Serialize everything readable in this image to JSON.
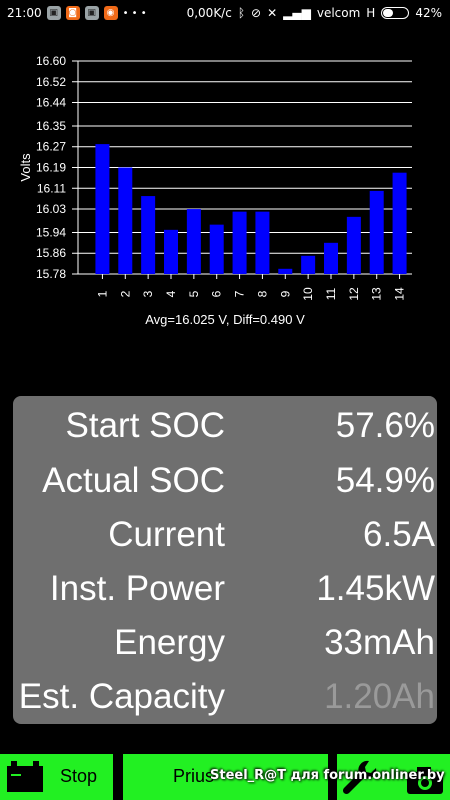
{
  "status_bar": {
    "time": "21:00",
    "more": "• • •",
    "net_speed": "0,00K/c",
    "carrier": "velcom",
    "network": "H",
    "battery": "42%",
    "battery_level": 0.42
  },
  "chart_data": {
    "type": "bar",
    "ylabel": "Volts",
    "xlabel": "",
    "categories": [
      "1",
      "2",
      "3",
      "4",
      "5",
      "6",
      "7",
      "8",
      "9",
      "10",
      "11",
      "12",
      "13",
      "14"
    ],
    "values": [
      16.28,
      16.19,
      16.08,
      15.95,
      16.03,
      15.97,
      16.02,
      16.02,
      15.8,
      15.85,
      15.9,
      16.0,
      16.1,
      16.17
    ],
    "ylim": [
      15.78,
      16.6
    ],
    "yticks": [
      "15.78",
      "15.86",
      "15.94",
      "16.03",
      "16.11",
      "16.19",
      "16.27",
      "16.35",
      "16.44",
      "16.52",
      "16.60"
    ],
    "grid": true,
    "bar_color": "#0000ff",
    "footer": "Avg=16.025 V, Diff=0.490 V"
  },
  "stats": [
    {
      "label": "Start SOC",
      "value": "57.6%"
    },
    {
      "label": "Actual SOC",
      "value": "54.9%"
    },
    {
      "label": "Current",
      "value": "6.5A"
    },
    {
      "label": "Inst. Power",
      "value": "1.45kW"
    },
    {
      "label": "Energy",
      "value": "33mAh"
    },
    {
      "label": "Est. Capacity",
      "value": "1.20Ah"
    }
  ],
  "buttons": {
    "stop": "Stop",
    "prius": "Prius"
  },
  "watermark": "Steel_R@T для forum.onliner.by",
  "colors": {
    "accent_green": "#22f022",
    "panel_gray": "#6f6f6f"
  }
}
